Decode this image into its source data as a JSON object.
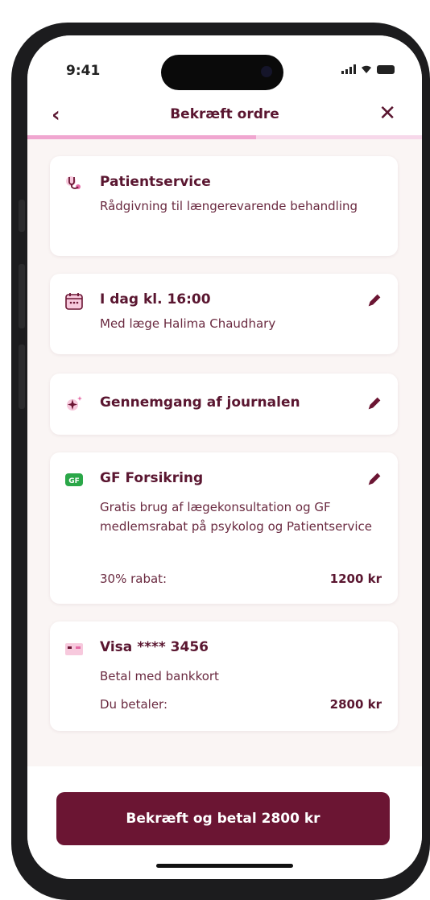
{
  "status_bar": {
    "time": "9:41"
  },
  "header": {
    "title": "Bekræft ordre",
    "back_icon": "chevron-left-icon",
    "close_icon": "close-icon"
  },
  "progress": {
    "fraction": 0.58
  },
  "cards": {
    "service": {
      "icon": "stethoscope-icon",
      "title": "Patientservice",
      "description": "Rådgivning til længerevarende behandling"
    },
    "appointment": {
      "icon": "calendar-icon",
      "title": "I dag kl. 16:00",
      "description": "Med læge Halima Chaudhary"
    },
    "reason": {
      "icon": "sparkle-icon",
      "title": "Gennemgang af journalen"
    },
    "insurance": {
      "icon": "gf-logo-icon",
      "title": "GF Forsikring",
      "description": "Gratis brug af lægekonsultation og GF medlemsrabat på psykolog og Patientservice",
      "discount_label": "30% rabat:",
      "discount_value": "1200 kr"
    },
    "payment": {
      "icon": "credit-card-icon",
      "title": "Visa **** 3456",
      "description": "Betal med bankkort",
      "total_label": "Du betaler:",
      "total_value": "2800 kr"
    }
  },
  "footer": {
    "confirm_label": "Bekræft og betal 2800 kr"
  },
  "colors": {
    "primary": "#6b1533",
    "text": "#5a1630",
    "progress_track": "#f7d8ea",
    "progress_fill": "#f0a6d0",
    "background": "#faf5f4"
  }
}
